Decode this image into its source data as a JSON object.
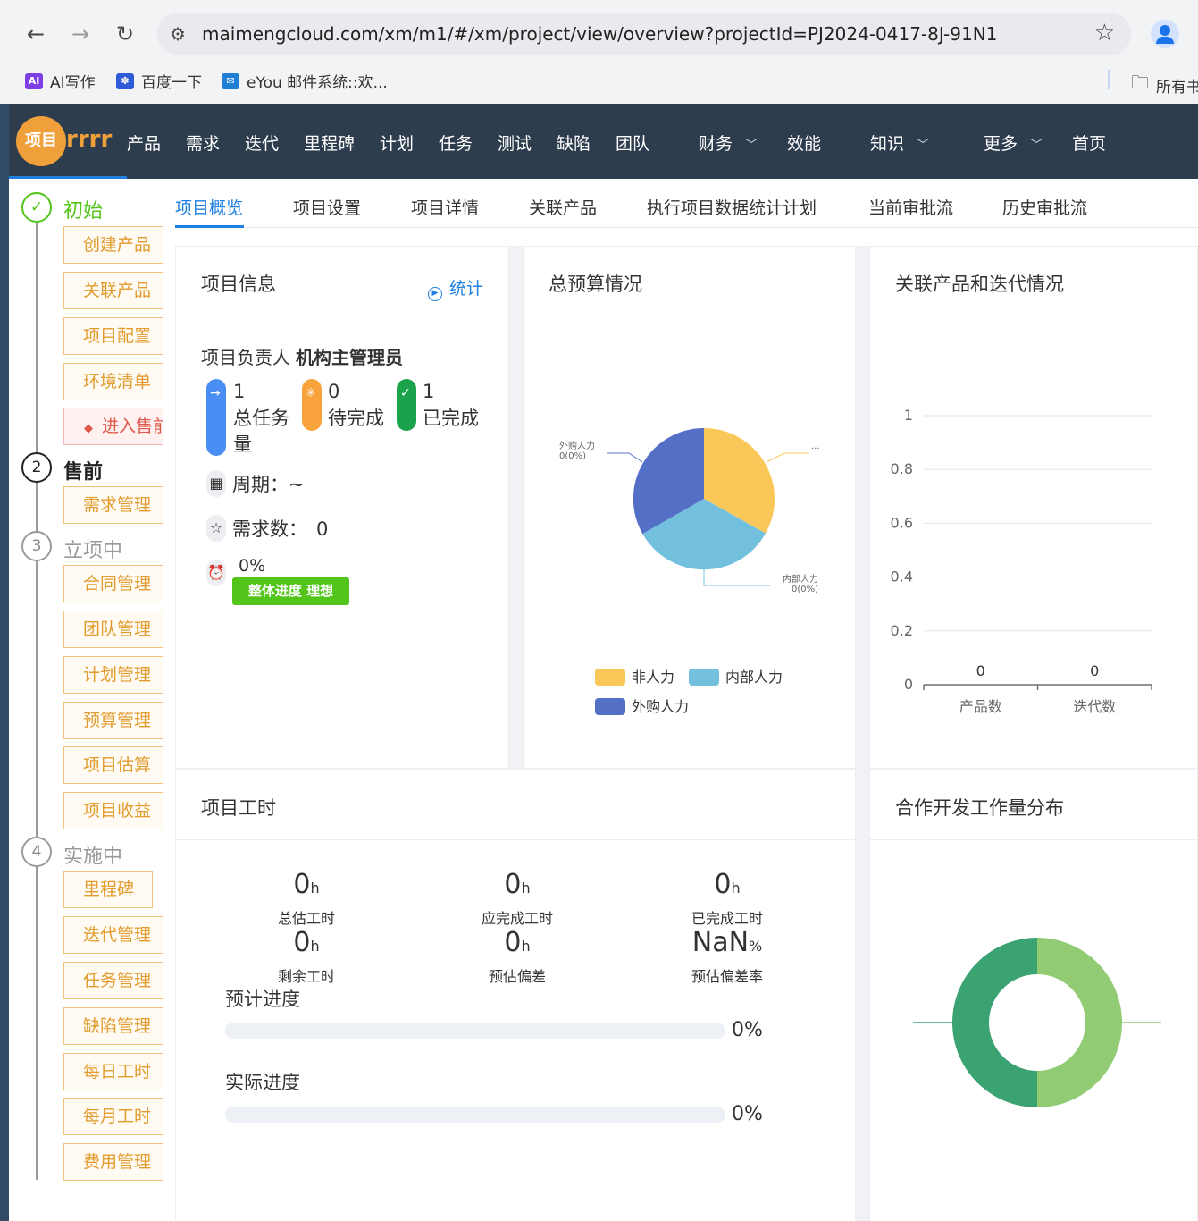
{
  "browser": {
    "url": "maimengcloud.com/xm/m1/#/xm/project/view/overview?projectId=PJ2024-0417-8J-91N1",
    "bookmarks": [
      {
        "label": "AI写作",
        "icon": "ai-writing-icon",
        "color": "#7b3fe4",
        "glyph": "AI"
      },
      {
        "label": "百度一下",
        "icon": "baidu-paw-icon",
        "color": "#2f5bd8",
        "glyph": "✽"
      },
      {
        "label": "eYou 邮件系统::欢...",
        "icon": "mail-icon",
        "color": "#1e7fd4",
        "glyph": "✉"
      }
    ],
    "bookmarks_folder": "所有书"
  },
  "header": {
    "logo_badge": "项目",
    "logo_name": "rrrr",
    "nav": [
      "产品",
      "需求",
      "迭代",
      "里程碑",
      "计划",
      "任务",
      "测试",
      "缺陷",
      "团队",
      "财务",
      "效能",
      "知识",
      "更多",
      "首页"
    ],
    "dropdown_items": [
      "财务",
      "知识",
      "更多"
    ]
  },
  "sidebar": {
    "phases": [
      {
        "num": "✓",
        "label": "初始",
        "state": "done",
        "items": [
          "创建产品",
          "关联产品",
          "项目配置",
          "环境清单"
        ],
        "action": "进入售前"
      },
      {
        "num": "2",
        "label": "售前",
        "state": "current",
        "items": [
          "需求管理"
        ]
      },
      {
        "num": "3",
        "label": "立项中",
        "state": "pending",
        "items": [
          "合同管理",
          "团队管理",
          "计划管理",
          "预算管理",
          "项目估算",
          "项目收益"
        ]
      },
      {
        "num": "4",
        "label": "实施中",
        "state": "pending",
        "items": [
          "里程碑",
          "迭代管理",
          "任务管理",
          "缺陷管理",
          "每日工时",
          "每月工时",
          "费用管理"
        ]
      }
    ]
  },
  "tabs": [
    "项目概览",
    "项目设置",
    "项目详情",
    "关联产品",
    "执行项目数据统计计划",
    "当前审批流",
    "历史审批流"
  ],
  "project_info": {
    "title": "项目信息",
    "stat_link": "统计",
    "owner_label": "项目负责人",
    "owner_name": "机构主管理员",
    "counts": [
      {
        "value": "1",
        "label": "总任务量",
        "color": "#4a8ef5",
        "icon": "arrow-right-icon"
      },
      {
        "value": "0",
        "label": "待完成",
        "color": "#f7a23b",
        "icon": "loading-icon"
      },
      {
        "value": "1",
        "label": "已完成",
        "color": "#1aa34a",
        "icon": "check-icon"
      }
    ],
    "period_label": "周期：",
    "period_value": "~",
    "req_label": "需求数：",
    "req_value": "0",
    "progress_pct": "0%",
    "progress_tag": "整体进度 理想"
  },
  "budget": {
    "title": "总预算情况",
    "slice_labels": {
      "outsourced": "外购人力",
      "outsourced_val": "0(0%)",
      "internal": "内部人力",
      "internal_val": "0(0%)",
      "nonlabor_val": "..."
    },
    "legend": [
      "非人力",
      "内部人力",
      "外购人力"
    ],
    "colors": {
      "nonlabor": "#fac858",
      "internal": "#73c0de",
      "outsourced": "#5470c6"
    }
  },
  "related": {
    "title": "关联产品和迭代情况",
    "chart_data": {
      "type": "bar",
      "categories": [
        "产品数",
        "迭代数"
      ],
      "values": [
        0,
        0
      ],
      "ylim": [
        0,
        1
      ],
      "yticks": [
        "0",
        "0.2",
        "0.4",
        "0.6",
        "0.8",
        "1"
      ]
    }
  },
  "hours": {
    "title": "项目工时",
    "items": [
      {
        "value": "0",
        "unit": "h",
        "label": "总估工时"
      },
      {
        "value": "0",
        "unit": "h",
        "label": "应完成工时"
      },
      {
        "value": "0",
        "unit": "h",
        "label": "已完成工时"
      },
      {
        "value": "0",
        "unit": "h",
        "label": "剩余工时"
      },
      {
        "value": "0",
        "unit": "h",
        "label": "预估偏差"
      },
      {
        "value": "NaN",
        "unit": "%",
        "label": "预估偏差率"
      }
    ],
    "planned_label": "预计进度",
    "planned_pct": "0%",
    "planned_value": 0,
    "actual_label": "实际进度",
    "actual_pct": "0%",
    "actual_value": 0
  },
  "coop": {
    "title": "合作开发工作量分布",
    "colors": [
      "#3ba272",
      "#91cc75"
    ]
  }
}
